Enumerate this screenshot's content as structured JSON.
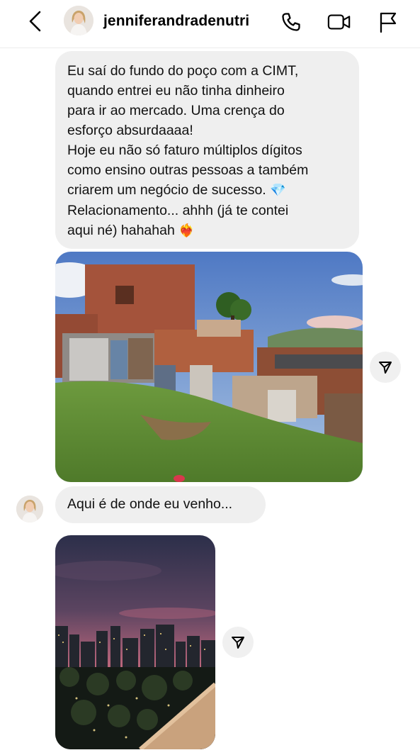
{
  "header": {
    "username": "jenniferandradenutri",
    "back_icon": "chevron-left-icon",
    "call_icon": "phone-icon",
    "video_icon": "video-camera-icon",
    "report_icon": "flag-icon"
  },
  "messages": {
    "first": {
      "lines": [
        "Eu saí do fundo do poço com a CIMT,",
        "quando entrei eu não tinha dinheiro",
        "para ir ao mercado. Uma crença do",
        "esforço absurdaaaa!",
        "Hoje eu não só faturo múltiplos dígitos",
        "como ensino outras pessoas a também",
        "criarem um negócio de sucesso.",
        "Relacionamento... ahhh (já te contei",
        "aqui né) hahahah"
      ],
      "emoji_1": "💎",
      "emoji_2": "❤️‍🔥"
    },
    "second": {
      "text": "Aqui é de onde eu venho..."
    }
  },
  "colors": {
    "bubble": "#efefef",
    "accent": "#000000"
  }
}
